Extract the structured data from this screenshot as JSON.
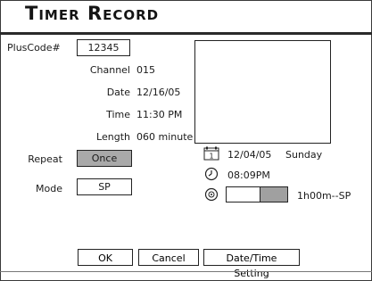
{
  "window": {
    "title": "Timer Record"
  },
  "fields": {
    "pluscode_label": "PlusCode#",
    "pluscode_value": "12345",
    "channel_label": "Channel",
    "channel_value": "015",
    "date_label": "Date",
    "date_value": "12/16/05",
    "time_label": "Time",
    "time_value": "11:30 PM",
    "length_label": "Length",
    "length_value": "060 minute",
    "repeat_label": "Repeat",
    "repeat_value": "Once",
    "mode_label": "Mode",
    "mode_value": "SP"
  },
  "status": {
    "current_date": "12/04/05",
    "current_day": "Sunday",
    "current_time": "08:09PM",
    "disc_remaining": "1h00m--SP",
    "disc_used_fraction": 0.45,
    "calendar_icon_day": "1"
  },
  "icons": {
    "calendar": "calendar-icon",
    "clock": "clock-icon",
    "disc": "disc-icon"
  },
  "buttons": {
    "ok": "OK",
    "cancel": "Cancel",
    "datetime": "Date/Time Setting"
  },
  "colors": {
    "selected_field": "#a9a9a9",
    "progress_fill": "#a0a0a0"
  }
}
